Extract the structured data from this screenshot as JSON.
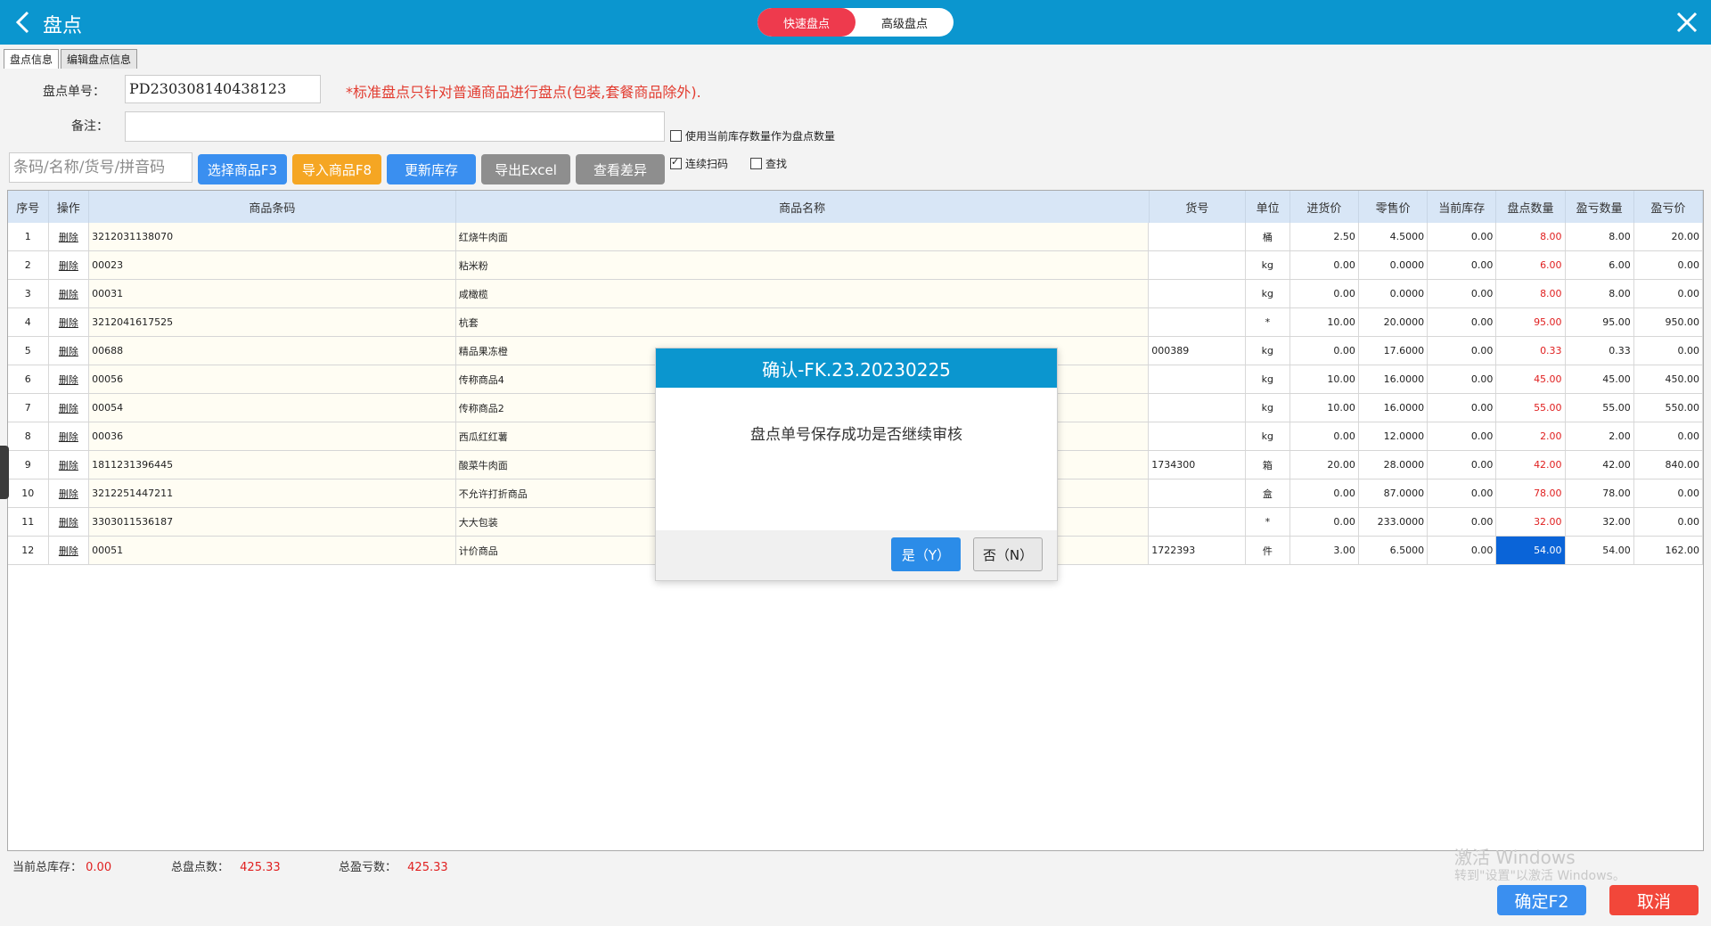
{
  "header": {
    "title": "盘点",
    "segments": [
      "快速盘点",
      "高级盘点"
    ],
    "active_segment": 0
  },
  "tabs": [
    "盘点信息",
    "编辑盘点信息"
  ],
  "form": {
    "order_no_label": "盘点单号：",
    "order_no_value": "PD230308140438123",
    "note": "*标准盘点只针对普通商品进行盘点(包装,套餐商品除外).",
    "remark_label": "备注：",
    "remark_value": "",
    "use_stock_label": "使用当前库存数量作为盘点数量",
    "search_placeholder": "条码/名称/货号/拼音码",
    "continuous_scan_label": "连续扫码",
    "find_label": "查找"
  },
  "toolbar": {
    "select_goods": "选择商品F3",
    "import_goods": "导入商品F8",
    "update_stock": "更新库存",
    "export_excel": "导出Excel",
    "view_diff": "查看差异"
  },
  "table": {
    "columns": [
      "序号",
      "操作",
      "商品条码",
      "商品名称",
      "货号",
      "单位",
      "进货价",
      "零售价",
      "当前库存",
      "盘点数量",
      "盈亏数量",
      "盈亏价"
    ],
    "rows": [
      {
        "no": "1",
        "op": "删除",
        "barcode": "3212031138070",
        "name": "红烧牛肉面",
        "sku": "",
        "unit": "桶",
        "cost": "2.50",
        "retail": "4.5000",
        "stock": "0.00",
        "count": "8.00",
        "diff": "8.00",
        "diff_amt": "20.00"
      },
      {
        "no": "2",
        "op": "删除",
        "barcode": "00023",
        "name": "粘米粉",
        "sku": "",
        "unit": "kg",
        "cost": "0.00",
        "retail": "0.0000",
        "stock": "0.00",
        "count": "6.00",
        "diff": "6.00",
        "diff_amt": "0.00"
      },
      {
        "no": "3",
        "op": "删除",
        "barcode": "00031",
        "name": "咸橄榄",
        "sku": "",
        "unit": "kg",
        "cost": "0.00",
        "retail": "0.0000",
        "stock": "0.00",
        "count": "8.00",
        "diff": "8.00",
        "diff_amt": "0.00"
      },
      {
        "no": "4",
        "op": "删除",
        "barcode": "3212041617525",
        "name": "杭套",
        "sku": "",
        "unit": "*",
        "cost": "10.00",
        "retail": "20.0000",
        "stock": "0.00",
        "count": "95.00",
        "diff": "95.00",
        "diff_amt": "950.00"
      },
      {
        "no": "5",
        "op": "删除",
        "barcode": "00688",
        "name": "精品果冻橙",
        "sku": "000389",
        "unit": "kg",
        "cost": "0.00",
        "retail": "17.6000",
        "stock": "0.00",
        "count": "0.33",
        "diff": "0.33",
        "diff_amt": "0.00"
      },
      {
        "no": "6",
        "op": "删除",
        "barcode": "00056",
        "name": "传称商品4",
        "sku": "",
        "unit": "kg",
        "cost": "10.00",
        "retail": "16.0000",
        "stock": "0.00",
        "count": "45.00",
        "diff": "45.00",
        "diff_amt": "450.00"
      },
      {
        "no": "7",
        "op": "删除",
        "barcode": "00054",
        "name": "传称商品2",
        "sku": "",
        "unit": "kg",
        "cost": "10.00",
        "retail": "16.0000",
        "stock": "0.00",
        "count": "55.00",
        "diff": "55.00",
        "diff_amt": "550.00"
      },
      {
        "no": "8",
        "op": "删除",
        "barcode": "00036",
        "name": "西瓜红红薯",
        "sku": "",
        "unit": "kg",
        "cost": "0.00",
        "retail": "12.0000",
        "stock": "0.00",
        "count": "2.00",
        "diff": "2.00",
        "diff_amt": "0.00"
      },
      {
        "no": "9",
        "op": "删除",
        "barcode": "1811231396445",
        "name": "酸菜牛肉面",
        "sku": "1734300",
        "unit": "箱",
        "cost": "20.00",
        "retail": "28.0000",
        "stock": "0.00",
        "count": "42.00",
        "diff": "42.00",
        "diff_amt": "840.00"
      },
      {
        "no": "10",
        "op": "删除",
        "barcode": "3212251447211",
        "name": "不允许打折商品",
        "sku": "",
        "unit": "盒",
        "cost": "0.00",
        "retail": "87.0000",
        "stock": "0.00",
        "count": "78.00",
        "diff": "78.00",
        "diff_amt": "0.00"
      },
      {
        "no": "11",
        "op": "删除",
        "barcode": "3303011536187",
        "name": "大大包装",
        "sku": "",
        "unit": "*",
        "cost": "0.00",
        "retail": "233.0000",
        "stock": "0.00",
        "count": "32.00",
        "diff": "32.00",
        "diff_amt": "0.00"
      },
      {
        "no": "12",
        "op": "删除",
        "barcode": "00051",
        "name": "计价商品",
        "sku": "1722393",
        "unit": "件",
        "cost": "3.00",
        "retail": "6.5000",
        "stock": "0.00",
        "count": "54.00",
        "diff": "54.00",
        "diff_amt": "162.00"
      }
    ]
  },
  "summary": {
    "stock_label": "当前总库存：",
    "stock_value": "0.00",
    "count_label": "总盘点数：",
    "count_value": "425.33",
    "diff_label": "总盈亏数：",
    "diff_value": "425.33"
  },
  "watermark": {
    "line1": "激活 Windows",
    "line2": "转到\"设置\"以激活 Windows。"
  },
  "footer": {
    "confirm": "确定F2",
    "cancel": "取消"
  },
  "dialog": {
    "title": "确认-FK.23.20230225",
    "message": "盘点单号保存成功是否继续审核",
    "yes": "是（Y）",
    "no": "否（N）"
  },
  "colors": {
    "primary": "#0b96cf",
    "accent_red": "#ee3a4d",
    "button_blue": "#3a8ff0",
    "button_orange": "#f5a623",
    "button_gray": "#8e8e8e",
    "selected_cell": "#0a64d8"
  }
}
